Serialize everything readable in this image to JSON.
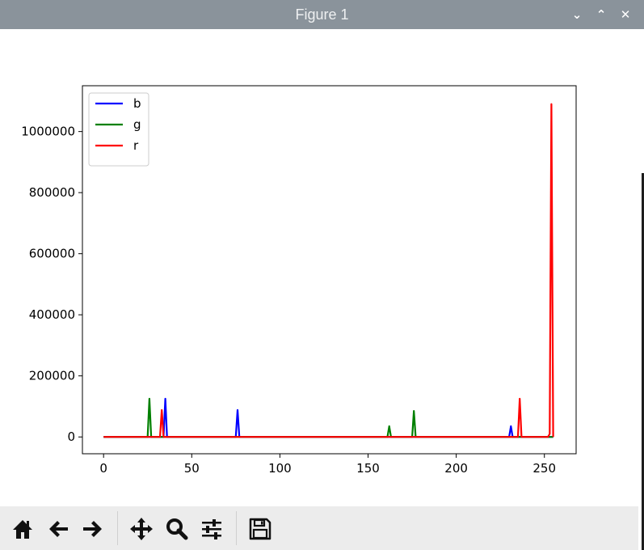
{
  "window": {
    "title": "Figure 1",
    "controls": [
      "minimize",
      "maximize",
      "close"
    ]
  },
  "toolbar": {
    "buttons": [
      {
        "name": "home",
        "icon": "home-icon"
      },
      {
        "name": "back",
        "icon": "arrow-left-icon"
      },
      {
        "name": "forward",
        "icon": "arrow-right-icon"
      },
      {
        "name": "pan",
        "icon": "move-icon"
      },
      {
        "name": "zoom",
        "icon": "magnifier-icon"
      },
      {
        "name": "configure-subplots",
        "icon": "sliders-icon"
      },
      {
        "name": "save",
        "icon": "floppy-disk-icon"
      }
    ]
  },
  "chart_data": {
    "type": "line",
    "title": "",
    "xlabel": "",
    "ylabel": "",
    "xlim": [
      -12,
      268
    ],
    "ylim": [
      -55000,
      1150000
    ],
    "xticks": [
      0,
      50,
      100,
      150,
      200,
      250
    ],
    "yticks": [
      0,
      200000,
      400000,
      600000,
      800000,
      1000000
    ],
    "grid": false,
    "legend": "top-left",
    "series": [
      {
        "name": "b",
        "color": "#0000ff",
        "points": [
          [
            0,
            0
          ],
          [
            34,
            0
          ],
          [
            35,
            125000
          ],
          [
            36,
            0
          ],
          [
            75,
            0
          ],
          [
            76,
            88000
          ],
          [
            77,
            0
          ],
          [
            230,
            0
          ],
          [
            231,
            35000
          ],
          [
            232,
            0
          ],
          [
            255,
            0
          ]
        ]
      },
      {
        "name": "g",
        "color": "#008000",
        "points": [
          [
            0,
            0
          ],
          [
            25,
            0
          ],
          [
            26,
            125000
          ],
          [
            27,
            0
          ],
          [
            161,
            0
          ],
          [
            162,
            35000
          ],
          [
            163,
            0
          ],
          [
            175,
            0
          ],
          [
            176,
            85000
          ],
          [
            177,
            0
          ],
          [
            255,
            0
          ]
        ]
      },
      {
        "name": "r",
        "color": "#ff0000",
        "points": [
          [
            0,
            0
          ],
          [
            32,
            0
          ],
          [
            33,
            88000
          ],
          [
            34,
            0
          ],
          [
            235,
            0
          ],
          [
            236,
            125000
          ],
          [
            237,
            0
          ],
          [
            252,
            0
          ],
          [
            253,
            10000
          ],
          [
            254,
            1090000
          ],
          [
            255,
            0
          ]
        ]
      }
    ]
  }
}
